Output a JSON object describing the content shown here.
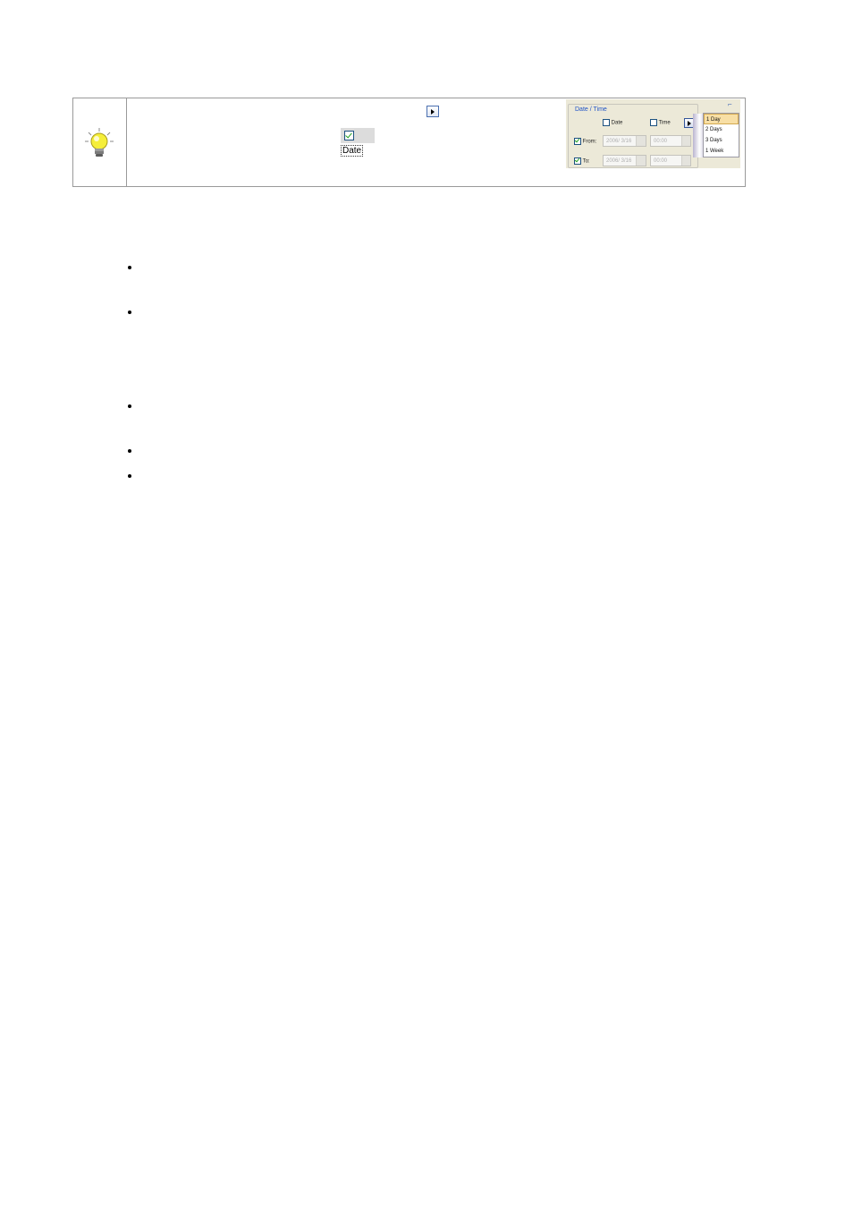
{
  "tip": {
    "inline_checkbox_label": "Date",
    "dialog": {
      "group_title": "Date / Time",
      "date_checkbox_label": "Date",
      "time_checkbox_label": "Time",
      "from_label": "From:",
      "to_label": "To:",
      "from_date": "2006/ 3/16",
      "from_time": "00:00",
      "to_date": "2006/ 3/16",
      "to_time": "00:00",
      "menu_items": [
        "1 Day",
        "2 Days",
        "3 Days",
        "1 Week"
      ]
    }
  },
  "icons": {
    "tip": "lightbulb-icon",
    "play": "play-arrow-icon",
    "checkbox": "checkbox-icon"
  },
  "colors": {
    "group_title": "#1f53c7",
    "menu_selected": "#f8dfa5",
    "check": "#21a121"
  }
}
